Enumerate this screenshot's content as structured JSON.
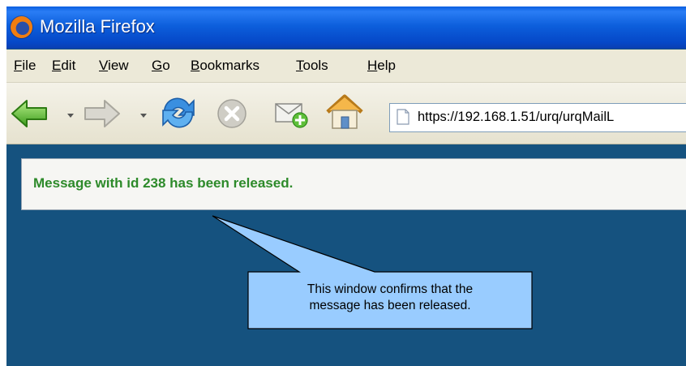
{
  "window": {
    "title": "Mozilla Firefox"
  },
  "menubar": {
    "items": [
      {
        "acc": "F",
        "rest": "ile"
      },
      {
        "acc": "E",
        "rest": "dit"
      },
      {
        "acc": "V",
        "rest": "iew"
      },
      {
        "acc": "G",
        "rest": "o"
      },
      {
        "acc": "B",
        "rest": "ookmarks"
      },
      {
        "acc": "T",
        "rest": "ools"
      },
      {
        "acc": "H",
        "rest": "elp"
      }
    ]
  },
  "toolbar": {
    "url": "https://192.168.1.51/urq/urqMailL",
    "icons": [
      "back-icon",
      "forward-icon",
      "reload-icon",
      "stop-icon",
      "new-mail-icon",
      "home-icon",
      "page-icon"
    ]
  },
  "message": {
    "text": "Message with id 238 has been released."
  },
  "callout": {
    "line1": "This window confirms that the",
    "line2": "message has been released."
  },
  "colors": {
    "page_background": "#15527f",
    "message_text": "#2d8a2a",
    "callout_fill": "#99ccff",
    "titlebar": "#0a5ee0"
  }
}
